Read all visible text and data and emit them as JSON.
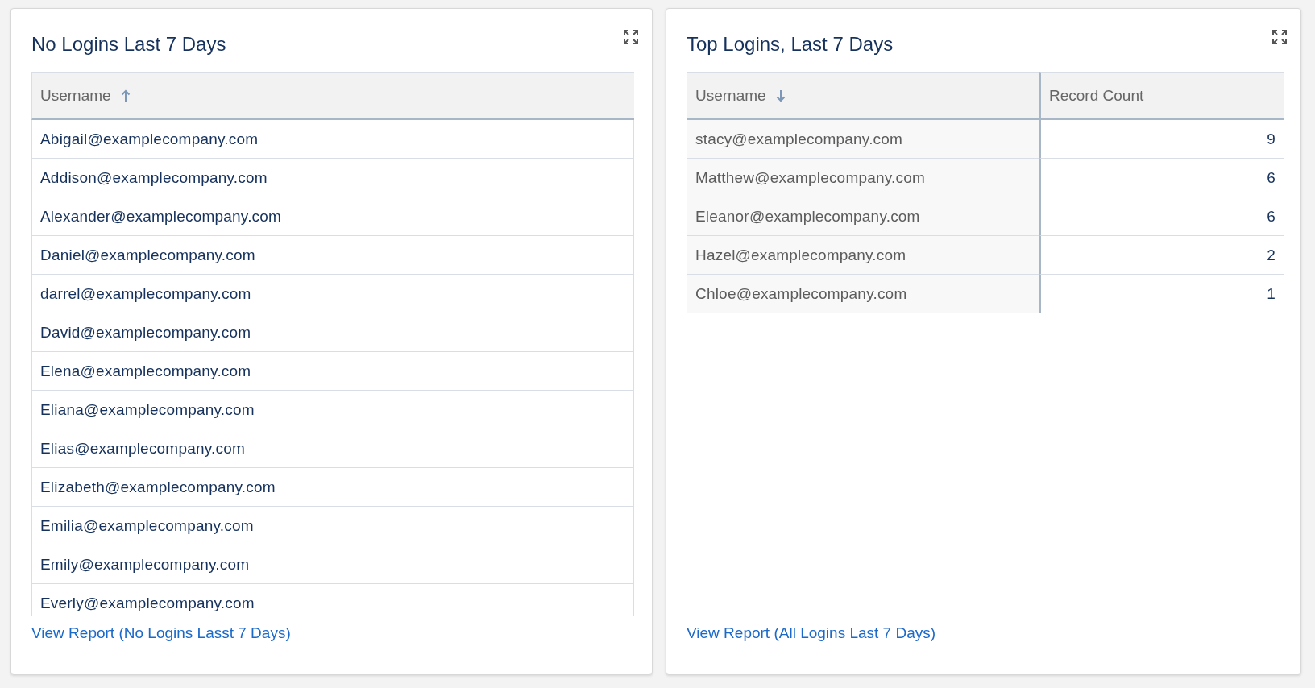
{
  "panels": [
    {
      "title": "No Logins Last 7 Days",
      "columns": [
        {
          "label": "Username",
          "sorted": true,
          "ascending": true,
          "kind": "text",
          "shaded": false
        }
      ],
      "rows": [
        [
          "Abigail@examplecompany.com"
        ],
        [
          "Addison@examplecompany.com"
        ],
        [
          "Alexander@examplecompany.com"
        ],
        [
          "Daniel@examplecompany.com"
        ],
        [
          "darrel@examplecompany.com"
        ],
        [
          "David@examplecompany.com"
        ],
        [
          "Elena@examplecompany.com"
        ],
        [
          "Eliana@examplecompany.com"
        ],
        [
          "Elias@examplecompany.com"
        ],
        [
          "Elizabeth@examplecompany.com"
        ],
        [
          "Emilia@examplecompany.com"
        ],
        [
          "Emily@examplecompany.com"
        ],
        [
          "Everly@examplecompany.com"
        ]
      ],
      "link": "View Report (No Logins Lasst 7 Days)"
    },
    {
      "title": "Top Logins, Last 7 Days",
      "columns": [
        {
          "label": "Username",
          "sorted": true,
          "ascending": false,
          "kind": "text",
          "shaded": true
        },
        {
          "label": "Record Count",
          "sorted": false,
          "kind": "number",
          "shaded": false
        }
      ],
      "rows": [
        [
          "stacy@examplecompany.com",
          "9"
        ],
        [
          "Matthew@examplecompany.com",
          "6"
        ],
        [
          "Eleanor@examplecompany.com",
          "6"
        ],
        [
          "Hazel@examplecompany.com",
          "2"
        ],
        [
          "Chloe@examplecompany.com",
          "1"
        ]
      ],
      "link": "View Report (All Logins Last 7 Days)"
    }
  ]
}
